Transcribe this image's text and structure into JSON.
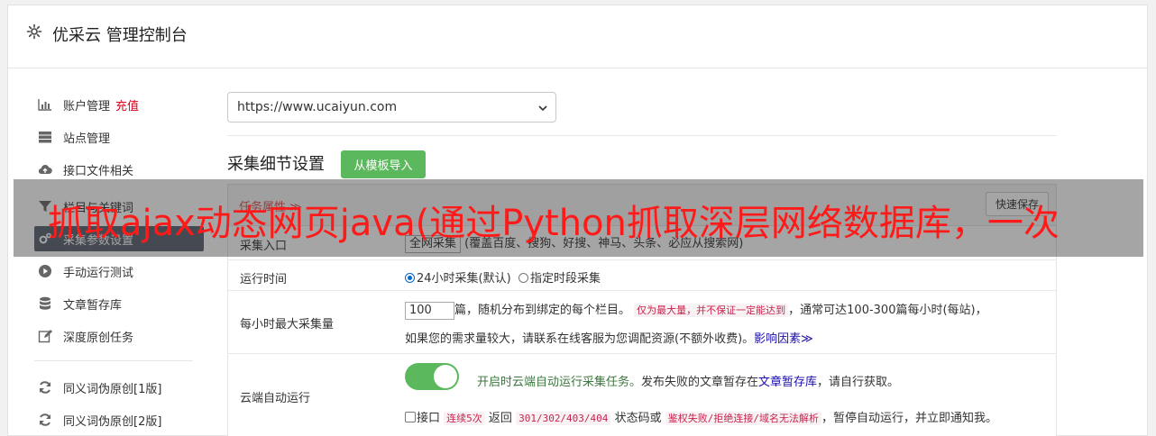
{
  "header": {
    "title": "优采云 管理控制台",
    "icon": "gear-icon"
  },
  "sidebar": {
    "items": [
      {
        "label": "账户管理",
        "tag": "充值",
        "icon": "bar-chart-icon"
      },
      {
        "label": "站点管理",
        "icon": "server-icon"
      },
      {
        "label": "接口文件相关",
        "icon": "cloud-upload-icon"
      },
      {
        "label": "栏目与关键词",
        "icon": "filter-icon"
      },
      {
        "label": "采集参数设置",
        "icon": "gears-icon"
      },
      {
        "label": "手动运行测试",
        "icon": "play-circle-icon"
      },
      {
        "label": "文章暂存库",
        "icon": "database-icon"
      },
      {
        "label": "深度原创任务",
        "icon": "edit-icon"
      },
      {
        "label": "同义词伪原创[1版]",
        "icon": "refresh-icon"
      },
      {
        "label": "同义词伪原创[2版]",
        "icon": "refresh-icon"
      }
    ]
  },
  "site_select": {
    "value": "https://www.ucaiyun.com"
  },
  "section": {
    "title": "采集细节设置",
    "import_button": "从模板导入"
  },
  "panel": {
    "title": "任务属性 ≫",
    "save_button": "快速保存",
    "rows": {
      "source": {
        "label": "采集入口",
        "input": "全网采集",
        "text": "(覆盖百度、搜狗、好搜、神马、头条、必应从搜索网)"
      },
      "runtime": {
        "label": "运行时间",
        "option1": "24小时采集(默认)",
        "option2": "指定时段采集"
      },
      "max_per_hour": {
        "label": "每小时最大采集量",
        "input": "100",
        "text1": "篇，随机分布到绑定的每个栏目。",
        "code1": "仅为最大量，并不保证一定能达到",
        "text2": "，通常可达100-300篇每小时(每站)，",
        "text3": "如果您的需求量较大，请联系在线客服为您调配资源(不额外收费)。",
        "link": "影响因素≫"
      },
      "cloud": {
        "label": "云端自动运行",
        "toggle_text": "开启时云端自动运行采集任务。",
        "text1": "发布失败的文章暂存在",
        "link": "文章暂存库",
        "text2": "，请自行获取。",
        "check_label": "接口",
        "code1": "连续5次",
        "text3": "返回",
        "code2": "301/302/403/404",
        "text4": "状态码或",
        "code3": "鉴权失败/拒绝连接/域名无法解析",
        "text5": "，暂停自动运行，并立即通知我。"
      }
    }
  },
  "overlay": {
    "text": "抓取ajax动态网页java(通过Python抓取深层网络数据库，一次"
  },
  "colors": {
    "accent_green": "#5cb85c",
    "active_menu": "#5a6370",
    "red_text": "#d9001b",
    "overlay_text": "#ff1a1a"
  }
}
